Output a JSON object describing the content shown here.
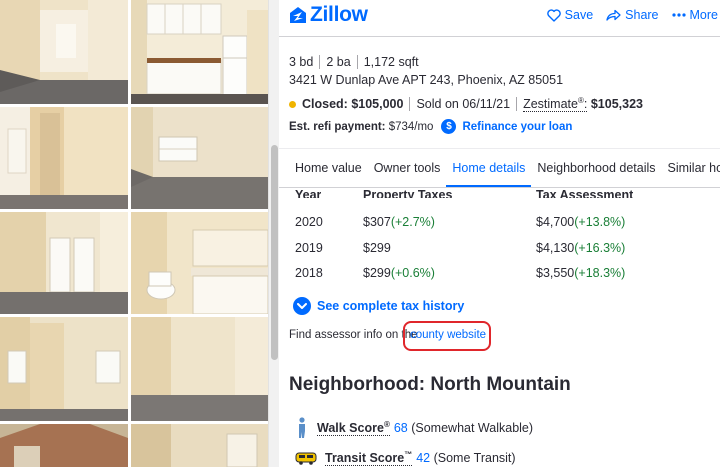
{
  "header": {
    "brand": "Zillow",
    "actions": [
      "Save",
      "Share",
      "More"
    ]
  },
  "facts": {
    "beds": "3 bd",
    "baths": "2 ba",
    "sqft": "1,172 sqft",
    "address": "3421 W Dunlap Ave APT 243, Phoenix, AZ 85051"
  },
  "status": {
    "closed_label": "Closed:",
    "closed_price": "$105,000",
    "sold_on": "Sold on 06/11/21",
    "zestimate_label": "Zestimate",
    "zestimate_reg": "®",
    "zestimate_sep": ":",
    "zestimate_value": "$105,323",
    "status_color": "#f0b400"
  },
  "refi": {
    "label": "Est. refi payment:",
    "amount": "$734/mo",
    "badge": "$",
    "link": "Refinance your loan"
  },
  "tabs": [
    "Home value",
    "Owner tools",
    "Home details",
    "Neighborhood details",
    "Similar homes"
  ],
  "active_tab": "Home details",
  "tax": {
    "headers": [
      "Year",
      "Property Taxes",
      "Tax Assessment"
    ],
    "rows": [
      {
        "year": "2020",
        "tax": "$307",
        "tax_change": "(+2.7%)",
        "assessment": "$4,700",
        "assessment_change": "(+13.8%)"
      },
      {
        "year": "2019",
        "tax": "$299",
        "tax_change": "",
        "assessment": "$4,130",
        "assessment_change": "(+16.3%)"
      },
      {
        "year": "2018",
        "tax": "$299",
        "tax_change": "(+0.6%)",
        "assessment": "$3,550",
        "assessment_change": "(+18.3%)"
      }
    ],
    "history_link": "See complete tax history"
  },
  "assessor": {
    "prefix": "Find assessor info on the",
    "link": "county website"
  },
  "neighborhood": {
    "title": "Neighborhood: North Mountain",
    "walk_label": "Walk Score",
    "walk_reg": "®",
    "walk_value": "68",
    "walk_desc": "(Somewhat Walkable)",
    "transit_label": "Transit Score",
    "transit_tm": "™",
    "transit_value": "42",
    "transit_desc": "(Some Transit)"
  },
  "colors": {
    "brand_blue": "#006aff",
    "positive_change": "#1a7f37",
    "highlight_red": "#e0262b"
  }
}
